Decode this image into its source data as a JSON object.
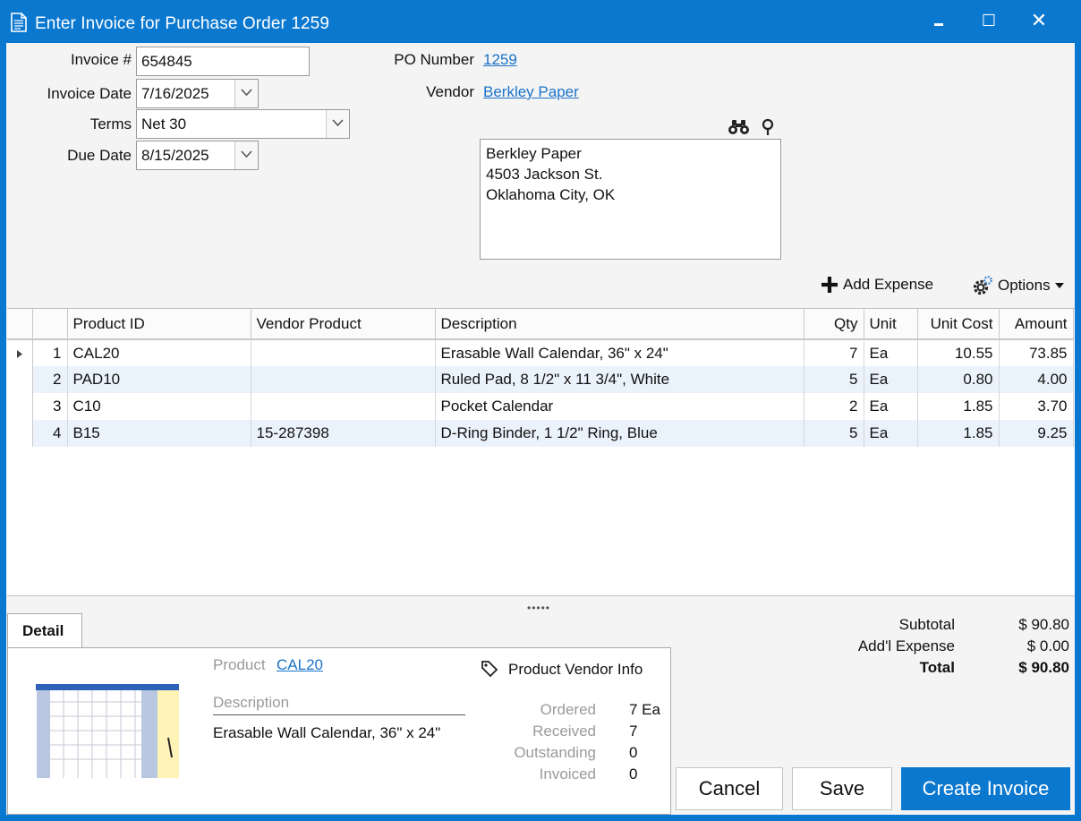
{
  "window": {
    "title": "Enter Invoice for Purchase Order 1259",
    "minimize_glyph": "▬",
    "maximize_glyph": "☐",
    "close_glyph": "✕"
  },
  "header": {
    "invoice_label": "Invoice #",
    "invoice_value": "654845",
    "invoice_date_label": "Invoice Date",
    "invoice_date_value": "7/16/2025",
    "terms_label": "Terms",
    "terms_value": "Net 30",
    "due_date_label": "Due Date",
    "due_date_value": "8/15/2025",
    "po_label": "PO Number",
    "po_value": "1259",
    "vendor_label": "Vendor",
    "vendor_value": "Berkley Paper",
    "address_lines": [
      "Berkley Paper",
      "4503 Jackson St.",
      "Oklahoma City, OK"
    ]
  },
  "toolbar": {
    "add_expense_label": "Add Expense",
    "options_label": "Options"
  },
  "grid": {
    "columns": [
      "Product ID",
      "Vendor Product",
      "Description",
      "Qty",
      "Unit",
      "Unit Cost",
      "Amount"
    ],
    "rows": [
      {
        "n": "1",
        "product_id": "CAL20",
        "vendor_product": "",
        "description": "Erasable Wall Calendar, 36\" x 24\"",
        "qty": "7",
        "unit": "Ea",
        "unit_cost": "10.55",
        "amount": "73.85"
      },
      {
        "n": "2",
        "product_id": "PAD10",
        "vendor_product": "",
        "description": "Ruled Pad, 8 1/2\" x 11 3/4\", White",
        "qty": "5",
        "unit": "Ea",
        "unit_cost": "0.80",
        "amount": "4.00"
      },
      {
        "n": "3",
        "product_id": "C10",
        "vendor_product": "",
        "description": "Pocket Calendar",
        "qty": "2",
        "unit": "Ea",
        "unit_cost": "1.85",
        "amount": "3.70"
      },
      {
        "n": "4",
        "product_id": "B15",
        "vendor_product": "15-287398",
        "description": "D-Ring Binder, 1 1/2\" Ring, Blue",
        "qty": "5",
        "unit": "Ea",
        "unit_cost": "1.85",
        "amount": "9.25"
      }
    ]
  },
  "splitter_glyph": "•••••",
  "detail": {
    "tab_label": "Detail",
    "product_label": "Product",
    "product_value": "CAL20",
    "description_label": "Description",
    "description_value": "Erasable Wall Calendar, 36\" x 24\"",
    "vendor_info_label": "Product Vendor Info",
    "ordered_label": "Ordered",
    "ordered_value": "7 Ea",
    "received_label": "Received",
    "received_value": "7",
    "outstanding_label": "Outstanding",
    "outstanding_value": "0",
    "invoiced_label": "Invoiced",
    "invoiced_value": "0"
  },
  "totals": {
    "subtotal_label": "Subtotal",
    "subtotal_value": "$ 90.80",
    "expense_label": "Add'l Expense",
    "expense_value": "$ 0.00",
    "total_label": "Total",
    "total_value": "$ 90.80"
  },
  "buttons": {
    "cancel": "Cancel",
    "save": "Save",
    "create": "Create Invoice"
  },
  "colors": {
    "accent": "#0b78d0",
    "link": "#1a73c8",
    "row_alt": "#eaf2fb"
  }
}
